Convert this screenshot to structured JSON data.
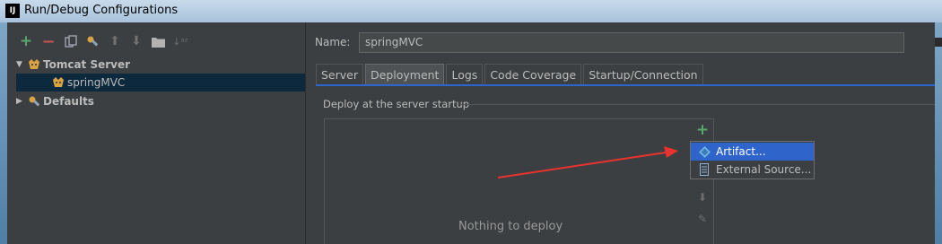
{
  "window": {
    "title": "Run/Debug Configurations",
    "app_icon_text": "IJ"
  },
  "left_toolbar": {
    "icons": [
      "add-icon",
      "remove-icon",
      "copy-icon",
      "edit-defaults-icon",
      "move-up-icon",
      "move-down-icon",
      "folder-icon",
      "sort-icon"
    ]
  },
  "tree": {
    "items": [
      {
        "label": "Tomcat Server",
        "expanded": true,
        "bold": true
      },
      {
        "label": "springMVC",
        "selected": true
      },
      {
        "label": "Defaults",
        "expanded": false,
        "bold": true
      }
    ]
  },
  "name_field": {
    "label": "Name:",
    "value": "springMVC"
  },
  "tabs": [
    {
      "label": "Server"
    },
    {
      "label": "Deployment",
      "active": true
    },
    {
      "label": "Logs"
    },
    {
      "label": "Code Coverage"
    },
    {
      "label": "Startup/Connection"
    }
  ],
  "deployment": {
    "section_title": "Deploy at the server startup",
    "empty_text": "Nothing to deploy",
    "add_menu": {
      "items": [
        {
          "label": "Artifact...",
          "highlighted": true
        },
        {
          "label": "External Source..."
        }
      ]
    }
  },
  "colors": {
    "accent": "#2f65ca",
    "selection": "#0d293e",
    "add_green": "#59a869",
    "remove_red": "#c75450",
    "annotation_arrow": "#e8322d"
  }
}
